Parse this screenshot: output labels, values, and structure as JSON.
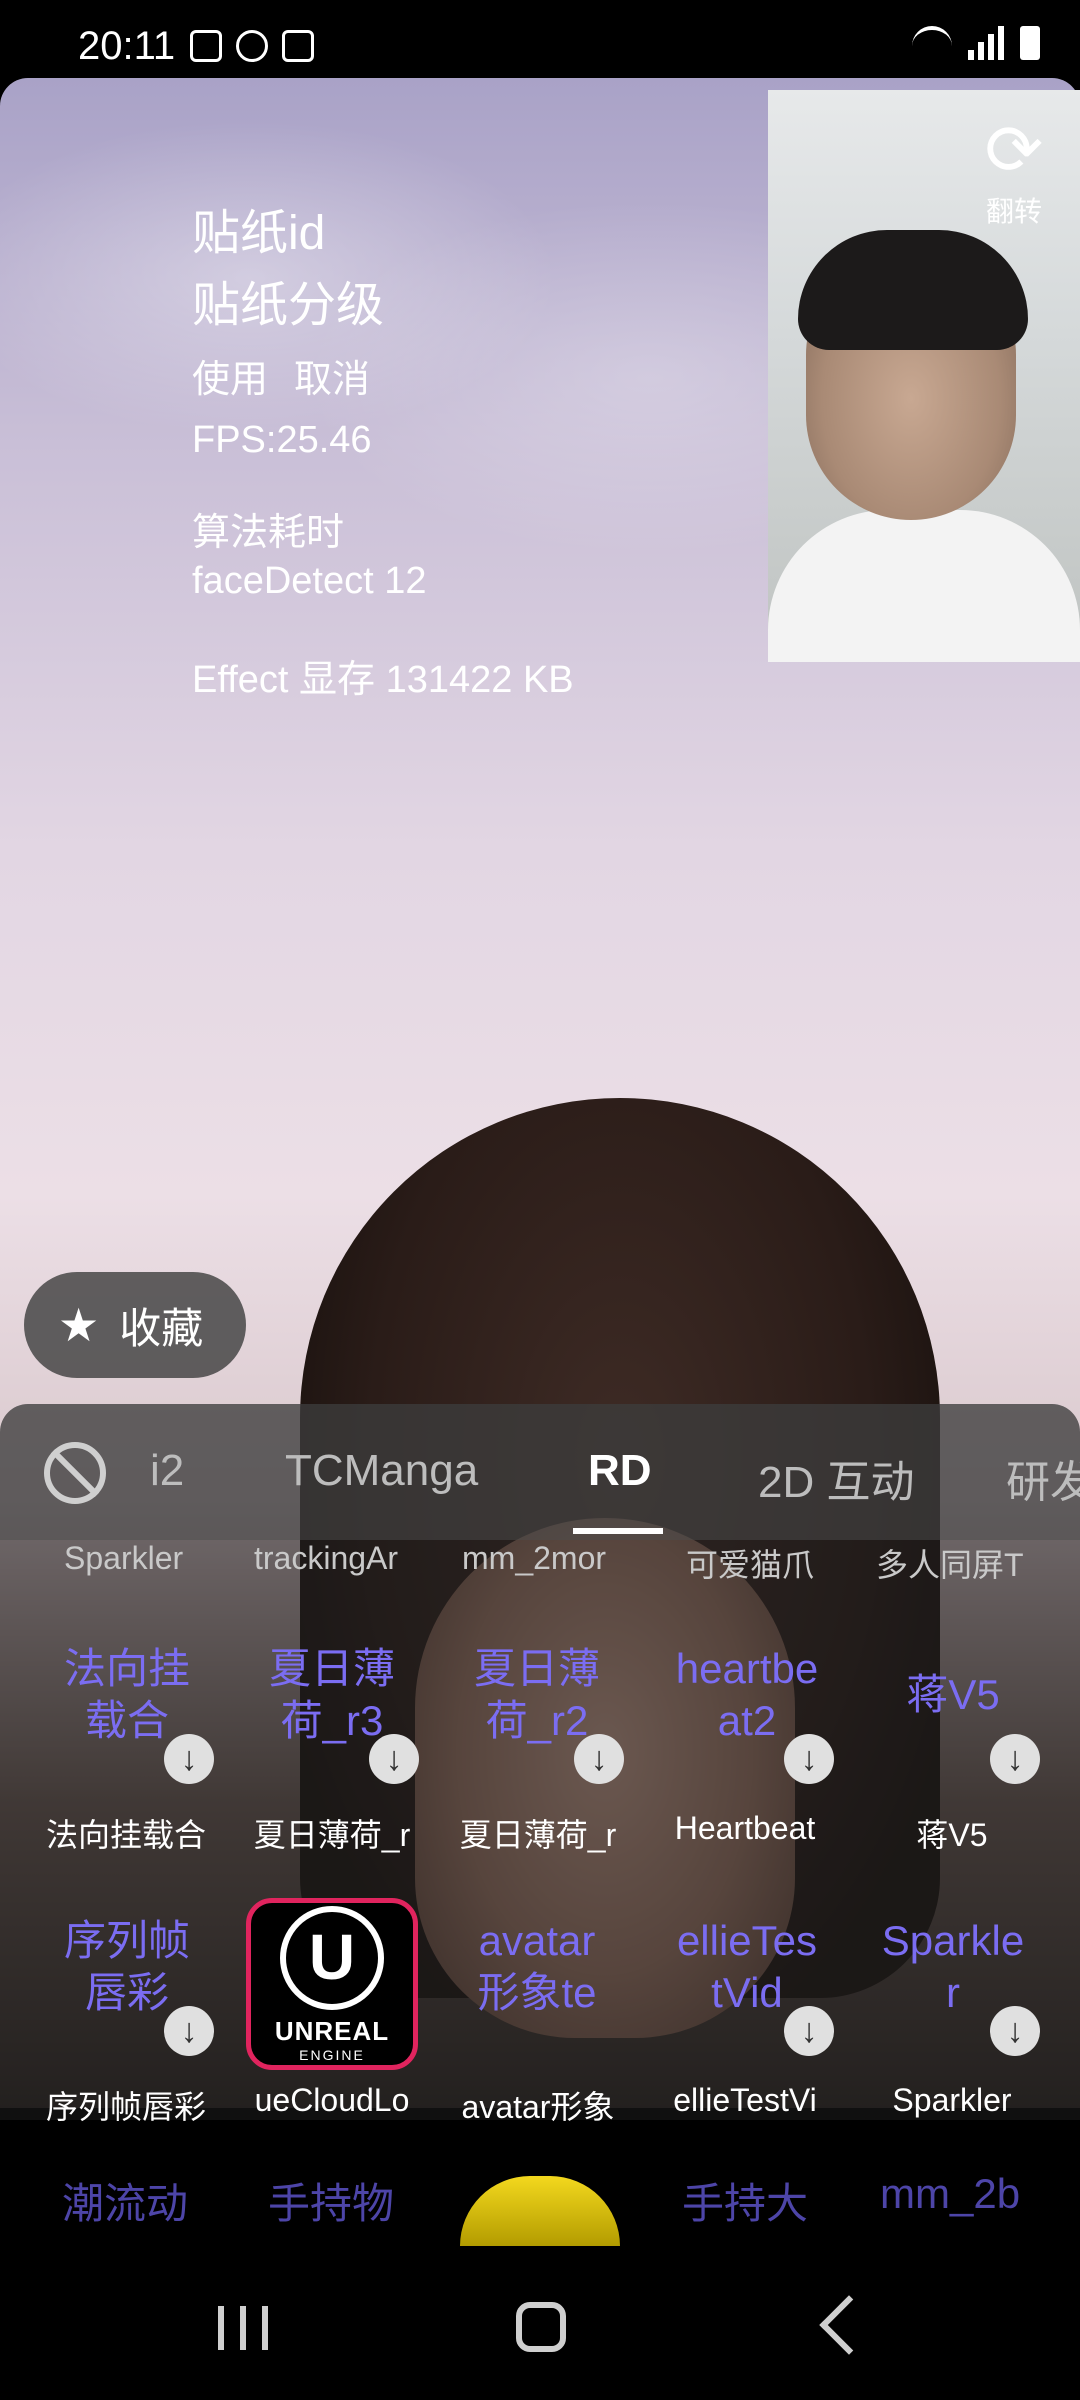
{
  "status_bar": {
    "time": "20:11"
  },
  "debug_panel": {
    "sticker_id": "贴纸id",
    "sticker_level": "贴纸分级",
    "use_label": "使用",
    "cancel_label": "取消",
    "fps": "FPS:25.46",
    "algo_title": "算法耗时",
    "face_detect": "faceDetect 12",
    "effect_memory": "Effect 显存 131422 KB"
  },
  "camera_preview": {
    "flip_label": "翻转"
  },
  "favorite": {
    "label": "收藏"
  },
  "tabs": {
    "items": [
      "i2",
      "TCManga",
      "RD",
      "2D 互动",
      "研发"
    ],
    "active": "RD"
  },
  "sticker_rows": {
    "partial_top": [
      "Sparkler",
      "trackingAr",
      "mm_2mor",
      "可爱猫爪",
      "多人同屏T"
    ],
    "row1": [
      {
        "thumb": "法向挂\n载合",
        "label": "法向挂载合"
      },
      {
        "thumb": "夏日薄\n荷_r3",
        "label": "夏日薄荷_r"
      },
      {
        "thumb": "夏日薄\n荷_r2",
        "label": "夏日薄荷_r"
      },
      {
        "thumb": "heartbe\nat2",
        "label": "Heartbeat"
      },
      {
        "thumb": "蒋V5",
        "label": "蒋V5"
      }
    ],
    "row2": [
      {
        "thumb": "序列帧\n唇彩",
        "label": "序列帧唇彩"
      },
      {
        "thumb": "UNREAL",
        "label": "ueCloudLo"
      },
      {
        "thumb": "avatar\n形象te",
        "label": "avatar形象"
      },
      {
        "thumb": "ellieTes\ntVid",
        "label": "ellieTestVi"
      },
      {
        "thumb": "Sparkle\nr",
        "label": "Sparkler"
      }
    ],
    "unreal": {
      "line1": "UNREAL",
      "line2": "ENGINE"
    },
    "bottom_partial": [
      "潮流动",
      "手持物",
      "手持大",
      "mm_2b"
    ]
  },
  "colors": {
    "accent_text": "#7b6df2",
    "shutter": "#f3d81e",
    "unreal_border": "#e0245e"
  }
}
